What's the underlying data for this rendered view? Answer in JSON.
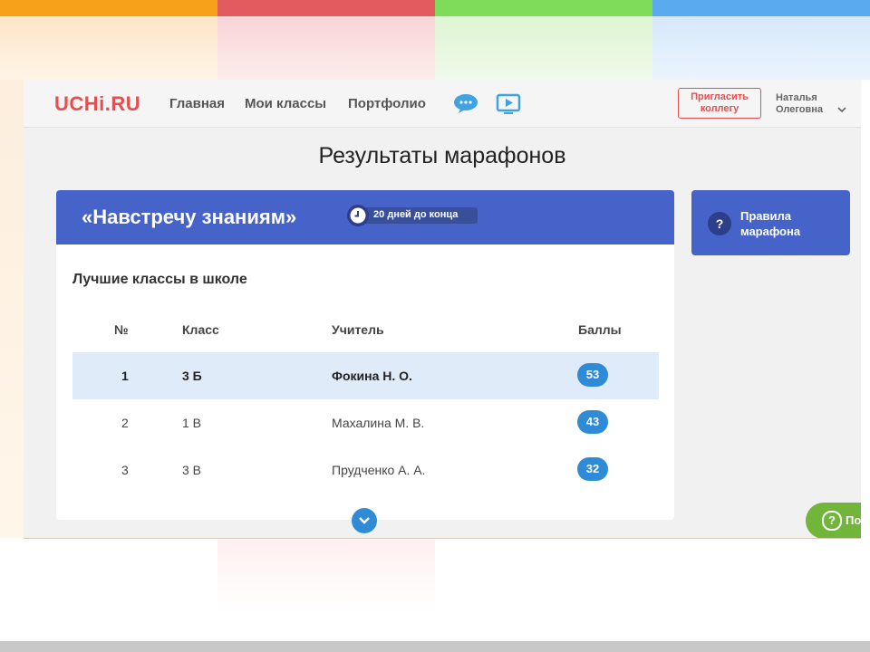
{
  "colors": {
    "bar_orange": "#f7a11a",
    "bar_red": "#e25b5e",
    "bar_green": "#7fdc5a",
    "bar_blue": "#5aaaf0",
    "accent_blue": "#4563c9",
    "score_blue": "#2f8bd6",
    "brand_red": "#e84e4e",
    "help_green": "#71b63a"
  },
  "header": {
    "logo": "UCHi.RU",
    "nav": [
      "Главная",
      "Мои классы",
      "Портфолио"
    ],
    "icons": [
      "chat-icon",
      "video-icon"
    ],
    "invite_line1": "Пригласить",
    "invite_line2": "коллегу",
    "user_first": "Наталья",
    "user_last": "Олеговна"
  },
  "page": {
    "title": "Результаты марафонов"
  },
  "marathon": {
    "name": "«Навстречу знаниям»",
    "deadline_number": "20",
    "deadline_text": "дней до конца"
  },
  "ranking": {
    "title": "Лучшие классы в школе",
    "columns": [
      "№",
      "Класс",
      "Учитель",
      "Баллы"
    ],
    "rows": [
      {
        "rank": "1",
        "class": "3 Б",
        "teacher": "Фокина Н. О.",
        "score": "53"
      },
      {
        "rank": "2",
        "class": "1 В",
        "teacher": "Махалина М. В.",
        "score": "43"
      },
      {
        "rank": "3",
        "class": "3 В",
        "teacher": "Прудченко А. А.",
        "score": "32"
      }
    ]
  },
  "rules": {
    "icon": "?",
    "line1": "Правила",
    "line2": "марафона"
  },
  "help": {
    "icon": "?",
    "label": "По"
  }
}
